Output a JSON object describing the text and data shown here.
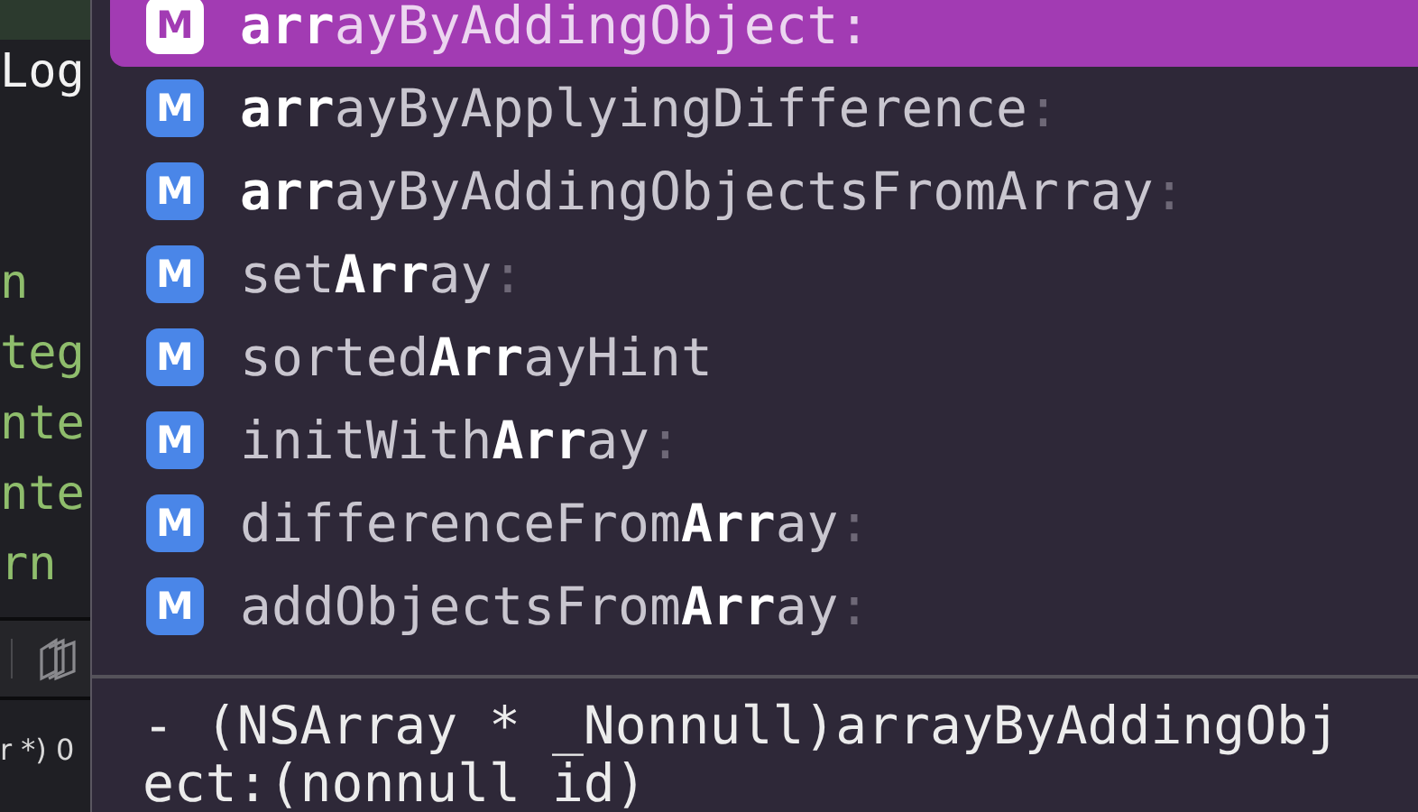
{
  "editor": {
    "code_lines": [
      {
        "highlighted": true
      },
      {
        "text": "Log",
        "kind": "plain",
        "highlighted": false
      },
      {
        "highlighted": false
      },
      {
        "highlighted": false
      },
      {
        "text": "n",
        "kind": "keyword",
        "highlighted": false
      },
      {
        "text": "teg",
        "kind": "keyword",
        "highlighted": false
      },
      {
        "text": "nte",
        "kind": "keyword",
        "highlighted": false
      },
      {
        "text": "nte",
        "kind": "keyword",
        "highlighted": false
      },
      {
        "text": "rn",
        "kind": "keyword",
        "highlighted": false
      }
    ],
    "debug_text": "r *) 0"
  },
  "completions": [
    {
      "kind": "method",
      "icon": "M",
      "name": "**arr**ayByAddingObject",
      "suffix": ":",
      "selected": true
    },
    {
      "kind": "method",
      "icon": "M",
      "name": "**arr**ayByApplyingDifference",
      "suffix": ":",
      "selected": false
    },
    {
      "kind": "method",
      "icon": "M",
      "name": "**arr**ayByAddingObjectsFromArray",
      "suffix": ":",
      "selected": false
    },
    {
      "kind": "method",
      "icon": "M",
      "name": "set**Arr**ay",
      "suffix": ":",
      "selected": false
    },
    {
      "kind": "method",
      "icon": "M",
      "name": "sorted**Arr**ayHint",
      "selected": false
    },
    {
      "kind": "method",
      "icon": "M",
      "name": "initWith**Arr**ay",
      "suffix": ":",
      "selected": false
    },
    {
      "kind": "method",
      "icon": "M",
      "name": "differenceFrom**Arr**ay",
      "suffix": ":",
      "selected": false
    },
    {
      "kind": "method",
      "icon": "M",
      "name": "addObjectsFrom**Arr**ay",
      "suffix": ":",
      "selected": false
    }
  ],
  "detail": {
    "signature_lines": [
      "- (NSArray * _Nonnull)arrayByAddingObj",
      "ect:(nonnull id)"
    ]
  }
}
